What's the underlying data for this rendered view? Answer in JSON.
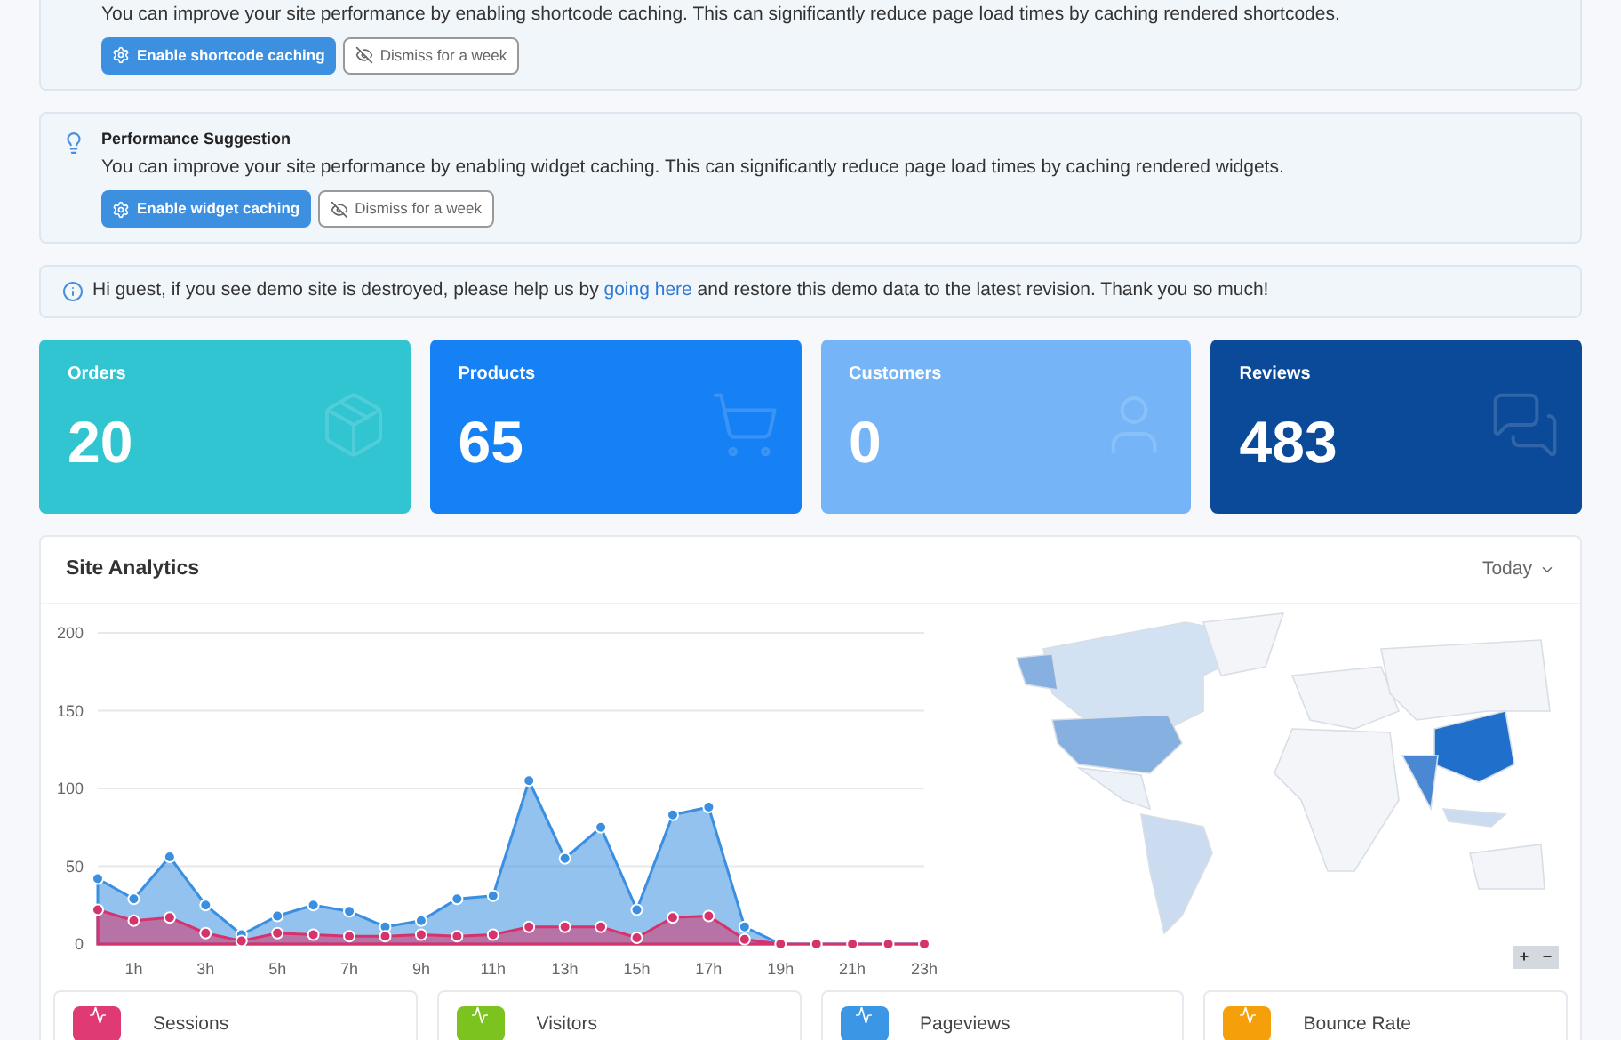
{
  "notices": [
    {
      "text": "You can improve your site performance by enabling shortcode caching. This can significantly reduce page load times by caching rendered shortcodes.",
      "primary_button": "Enable shortcode caching",
      "secondary_button": "Dismiss for a week"
    },
    {
      "title": "Performance Suggestion",
      "text": "You can improve your site performance by enabling widget caching. This can significantly reduce page load times by caching rendered widgets.",
      "primary_button": "Enable widget caching",
      "secondary_button": "Dismiss for a week"
    }
  ],
  "alert": {
    "before": "Hi guest, if you see demo site is destroyed, please help us by",
    "link": "going here",
    "after": "and restore this demo data to the latest revision. Thank you so much!"
  },
  "stats": [
    {
      "label": "Orders",
      "value": "20",
      "kind": "orders",
      "color": "#31c5d2"
    },
    {
      "label": "Products",
      "value": "65",
      "kind": "products",
      "color": "#1681f4"
    },
    {
      "label": "Customers",
      "value": "0",
      "kind": "customers",
      "color": "#75b5f7"
    },
    {
      "label": "Reviews",
      "value": "483",
      "kind": "reviews",
      "color": "#0b4a99"
    }
  ],
  "analytics": {
    "title": "Site Analytics",
    "range": "Today",
    "chart_data": {
      "type": "area",
      "x": [
        0,
        1,
        2,
        3,
        4,
        5,
        6,
        7,
        8,
        9,
        10,
        11,
        12,
        13,
        14,
        15,
        16,
        17,
        18,
        19,
        20,
        21,
        22,
        23
      ],
      "xticks": [
        {
          "value": 1,
          "label": "1h"
        },
        {
          "value": 3,
          "label": "3h"
        },
        {
          "value": 5,
          "label": "5h"
        },
        {
          "value": 7,
          "label": "7h"
        },
        {
          "value": 9,
          "label": "9h"
        },
        {
          "value": 11,
          "label": "11h"
        },
        {
          "value": 13,
          "label": "13h"
        },
        {
          "value": 15,
          "label": "15h"
        },
        {
          "value": 17,
          "label": "17h"
        },
        {
          "value": 19,
          "label": "19h"
        },
        {
          "value": 21,
          "label": "21h"
        },
        {
          "value": 23,
          "label": "23h"
        }
      ],
      "xlim": [
        0,
        23
      ],
      "yticks": [
        0,
        50,
        100,
        150,
        200
      ],
      "ylim": [
        0,
        200
      ],
      "grid": true,
      "series": [
        {
          "color": "#3b8fe0",
          "values": [
            42,
            29,
            56,
            25,
            6,
            18,
            25,
            21,
            11,
            15,
            29,
            31,
            105,
            55,
            75,
            22,
            83,
            88,
            11,
            0,
            0,
            0,
            0,
            0
          ]
        },
        {
          "color": "#d6336c",
          "values": [
            22,
            15,
            17,
            7,
            2,
            7,
            6,
            5,
            5,
            6,
            5,
            6,
            11,
            11,
            11,
            4,
            17,
            18,
            3,
            0,
            0,
            0,
            0,
            0
          ]
        }
      ]
    },
    "zoom_in": "+",
    "zoom_out": "−",
    "metrics": [
      {
        "label": "Sessions",
        "color": "#e03a75"
      },
      {
        "label": "Visitors",
        "color": "#7cc31f"
      },
      {
        "label": "Pageviews",
        "color": "#3b97e6"
      },
      {
        "label": "Bounce Rate",
        "color": "#f59f0b"
      }
    ]
  }
}
